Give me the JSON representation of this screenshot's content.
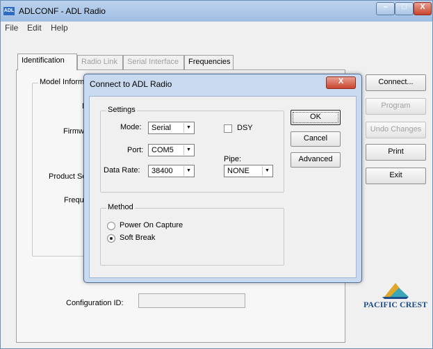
{
  "window": {
    "title": "ADLCONF - ADL Radio",
    "app_icon_text": "ADL",
    "minimize_glyph": "–",
    "maximize_glyph": "□",
    "close_glyph": "X"
  },
  "menu": [
    "File",
    "Edit",
    "Help"
  ],
  "tabs": [
    {
      "label": "Identification",
      "enabled": true
    },
    {
      "label": "Radio Link",
      "enabled": false
    },
    {
      "label": "Serial Interface",
      "enabled": false
    },
    {
      "label": "Frequencies",
      "enabled": true
    }
  ],
  "identification": {
    "group_label": "Model Inform",
    "labels": [
      "M",
      "Firmw",
      "Product Se",
      "Freque"
    ],
    "configuration_id_label": "Configuration ID:",
    "configuration_id_value": ""
  },
  "side_buttons": [
    {
      "label": "Connect...",
      "enabled": true
    },
    {
      "label": "Program",
      "enabled": false
    },
    {
      "label": "Undo Changes",
      "enabled": false
    },
    {
      "label": "Print",
      "enabled": true
    },
    {
      "label": "Exit",
      "enabled": true
    }
  ],
  "logo": {
    "text": "PACIFIC CREST",
    "colors": {
      "blue": "#1f4e8c",
      "gold": "#e2a72a",
      "teal": "#3aa7b7"
    }
  },
  "dialog": {
    "title": "Connect to ADL Radio",
    "close_glyph": "X",
    "settings_label": "Settings",
    "mode_label": "Mode:",
    "mode_value": "Serial",
    "dsy_label": "DSY",
    "dsy_checked": false,
    "port_label": "Port:",
    "port_value": "COM5",
    "pipe_label": "Pipe:",
    "pipe_value": "NONE",
    "data_rate_label": "Data Rate:",
    "data_rate_value": "38400",
    "dropdown_glyph": "▼",
    "method_label": "Method",
    "methods": [
      {
        "label": "Power On Capture",
        "selected": false
      },
      {
        "label": "Soft Break",
        "selected": true
      }
    ],
    "buttons": {
      "ok": "OK",
      "cancel": "Cancel",
      "advanced": "Advanced"
    }
  }
}
